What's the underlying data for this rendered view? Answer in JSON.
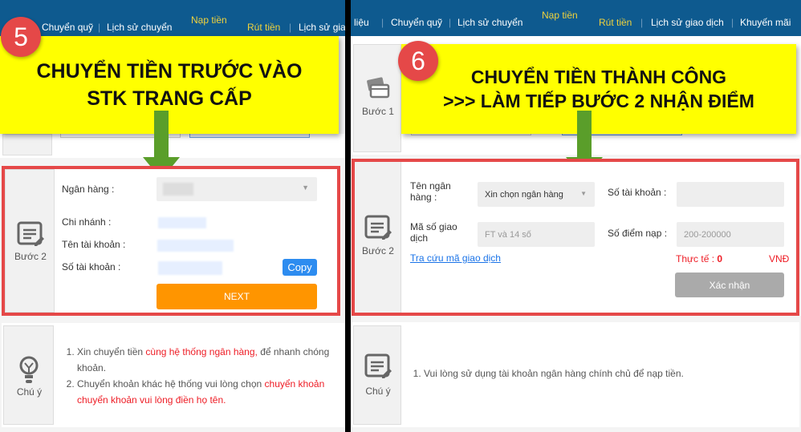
{
  "left": {
    "nav": [
      "Chuyển quỹ",
      "Lịch sử chuyển",
      "Nạp tiền",
      "Rút tiền",
      "Lịch sử giao"
    ],
    "badge": "5",
    "callout": [
      "CHUYỂN TIỀN TRƯỚC VÀO",
      "STK TRANG CẤP"
    ],
    "step2": {
      "side_label": "Bước 2",
      "bank_label": "Ngân hàng :",
      "branch_label": "Chi nhánh :",
      "account_name_label": "Tên tài khoản :",
      "account_no_label": "Số tài khoản :",
      "copy": "Copy",
      "next": "NEXT"
    },
    "note": {
      "side_label": "Chú ý",
      "item1_a": "Xin chuyển tiền ",
      "item1_red": "cùng hệ thống ngân hàng,",
      "item1_b": " để nhanh chóng",
      "item1_c": "khoản.",
      "item2_a": "Chuyển khoản khác hệ thống vui lòng chọn ",
      "item2_red": "chuyển khoản",
      "item2_red2": "chuyển khoản vui lòng điền họ tên."
    }
  },
  "right": {
    "nav": [
      "liệu",
      "Chuyển quỹ",
      "Lịch sử chuyển",
      "Nạp tiền",
      "Rút tiền",
      "Lịch sử giao dịch",
      "Khuyến mãi"
    ],
    "badge": "6",
    "callout": [
      "CHUYỂN TIỀN THÀNH CÔNG",
      ">>> LÀM TIẾP BƯỚC 2 NHẬN ĐIỂM"
    ],
    "step1_label": "Bước 1",
    "step2": {
      "side_label": "Bước 2",
      "bank_label": "Tên ngân hàng :",
      "bank_select": "Xin chọn ngân hàng",
      "account_label": "Số tài khoản :",
      "txn_label": "Mã số giao dịch",
      "txn_placeholder": "FT và 14 số",
      "points_label": "Số điểm nạp :",
      "points_placeholder": "200-200000",
      "lookup_link": "Tra cứu mã giao dịch",
      "actual_label": "Thực tế : ",
      "actual_value": "0",
      "currency": "VNĐ",
      "confirm": "Xác nhận"
    },
    "note": {
      "side_label": "Chú ý",
      "item1": "Vui lòng sử dụng tài khoản ngân hàng chính chủ để nạp tiền."
    }
  },
  "colors": {
    "nav": "#0e5a8f",
    "highlight": "#ffff00",
    "step_border": "#e54848",
    "next": "#ff9500",
    "copy": "#2d8cf0"
  }
}
